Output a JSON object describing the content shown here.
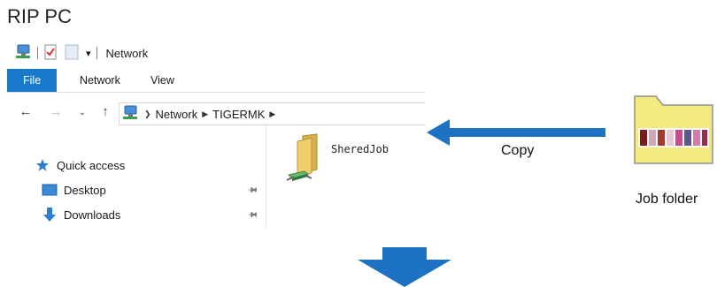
{
  "heading": "RIP PC",
  "window": {
    "title": "Network",
    "tabs": [
      "File",
      "Network",
      "View"
    ],
    "address": {
      "crumbs": [
        "Network",
        "TIGERMK"
      ]
    },
    "nav": [
      {
        "label": "Quick access",
        "icon": "star-icon"
      },
      {
        "label": "Desktop",
        "icon": "desktop-icon"
      },
      {
        "label": "Downloads",
        "icon": "download-icon"
      }
    ],
    "content": {
      "folder_label": "SheredJob"
    }
  },
  "copy_label": "Copy",
  "job_folder_label": "Job folder",
  "colors": {
    "arrow": "#1e72c4",
    "file_tab": "#1979ca",
    "folder": "#f2ea7c"
  }
}
